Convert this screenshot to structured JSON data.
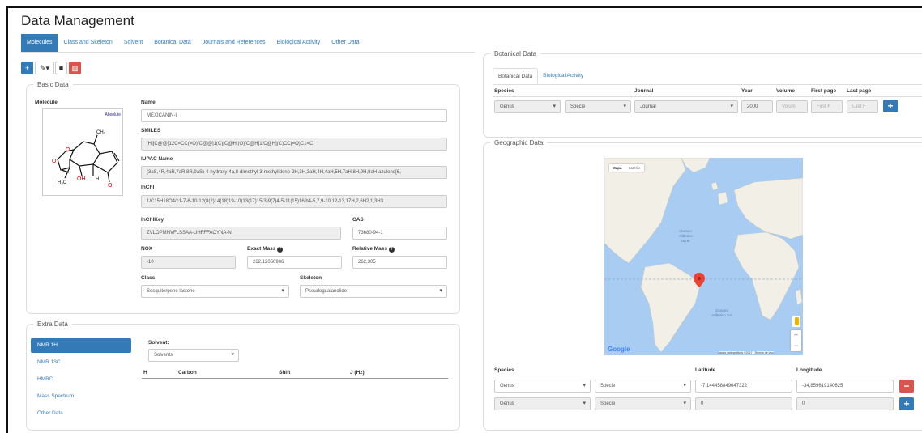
{
  "app": {
    "title": "Data Management"
  },
  "tabs": [
    {
      "label": "Molecules"
    },
    {
      "label": "Class and Skeleton"
    },
    {
      "label": "Solvent"
    },
    {
      "label": "Botanical Data"
    },
    {
      "label": "Journals and References"
    },
    {
      "label": "Biological Activity"
    },
    {
      "label": "Other Data"
    }
  ],
  "basic": {
    "legend": "Basic Data",
    "molecule_label": "Molecule",
    "absolute_label": "Absolute",
    "structure_labels": {
      "ch3": "CH₃",
      "h3c": "H₃C",
      "oh": "OH",
      "h": "H",
      "o1": "O",
      "o2": "O",
      "o3": "O",
      "o4": "O"
    },
    "name": {
      "label": "Name",
      "value": "MEXICANIN-I"
    },
    "smiles": {
      "label": "SMILES",
      "value": "[H][C@@]12C=CC(=O)[C@@]1(C)[C@H](O)[C@H]1[C@H](C)CC(=O)C1=C"
    },
    "iupac": {
      "label": "IUPAC Name",
      "value": "(3aS,4R,4aR,7aR,8R,9aS)-4-hydroxy-4a,8-dimethyl-3-methylidene-2H,3H,3aH,4H,4aH,5H,7aH,8H,9H,9aH-azuleno[6,"
    },
    "inchi": {
      "label": "InChI",
      "value": "1/C15H18O4/c1-7-6-10-12(8(2)14(18)19-10)13(17)15(3)9(7)4-5-11(15)16/h4-5,7,9-10,12-13,17H,2,6H2,1,3H3"
    },
    "inchikey": {
      "label": "InChIKey",
      "value": "ZVLOPMNVFLSSAA-UHFFFAOYNA-N"
    },
    "cas": {
      "label": "CAS",
      "value": "73680-94-1"
    },
    "nox": {
      "label": "NOX",
      "value": "-10"
    },
    "exact_mass": {
      "label": "Exact Mass",
      "value": "262,12050906"
    },
    "relative_mass": {
      "label": "Relative Mass",
      "value": "262,305"
    },
    "class": {
      "label": "Class",
      "value": "Sesquiterpene lactone"
    },
    "skeleton": {
      "label": "Skeleton",
      "value": "Pseudoguaianolide"
    }
  },
  "extra": {
    "legend": "Extra Data",
    "items": [
      {
        "label": "NMR 1H"
      },
      {
        "label": "NMR 13C"
      },
      {
        "label": "HMBC"
      },
      {
        "label": "Mass Spectrum"
      },
      {
        "label": "Other Data"
      }
    ],
    "solvent_label": "Solvent:",
    "solvent_value": "Solvents",
    "columns": [
      "H",
      "Carbon",
      "Shift",
      "J (Hz)"
    ]
  },
  "botanical": {
    "legend": "Botanical Data",
    "tabs": [
      {
        "label": "Botanical Data"
      },
      {
        "label": "Biological Activity"
      }
    ],
    "headers": {
      "species": "Species",
      "journal": "Journal",
      "year": "Year",
      "volume": "Volume",
      "first_page": "First page",
      "last_page": "Last page"
    },
    "row": {
      "genus": "Genus",
      "specie": "Specie",
      "journal": "Journal",
      "year": "2000",
      "volume": "Volum",
      "first_page": "First F",
      "last_page": "Last F"
    }
  },
  "geo": {
    "legend": "Geographic Data",
    "map": {
      "type_map": "Mapa",
      "type_sat": "Satélite",
      "ocean_n1": "Oceano",
      "ocean_n2": "Atlântico",
      "ocean_n3": "Norte",
      "ocean_s1": "Oceano",
      "ocean_s2": "Atlântico Sul",
      "google": "Google",
      "attribution": "Dados cartográficos ©2017",
      "terms": "Termos de Uso",
      "zoom_in": "+",
      "zoom_out": "−"
    },
    "headers": {
      "species": "Species",
      "latitude": "Latitude",
      "longitude": "Longitude"
    },
    "rows": [
      {
        "genus": "Genus",
        "specie": "Specie",
        "latitude": "-7,144458849647322",
        "longitude": "-34,859619140625"
      },
      {
        "genus": "Genus",
        "specie": "Specie",
        "latitude": "0",
        "longitude": "0"
      }
    ]
  },
  "colors": {
    "primary": "#337ab7",
    "danger": "#d9534f"
  }
}
